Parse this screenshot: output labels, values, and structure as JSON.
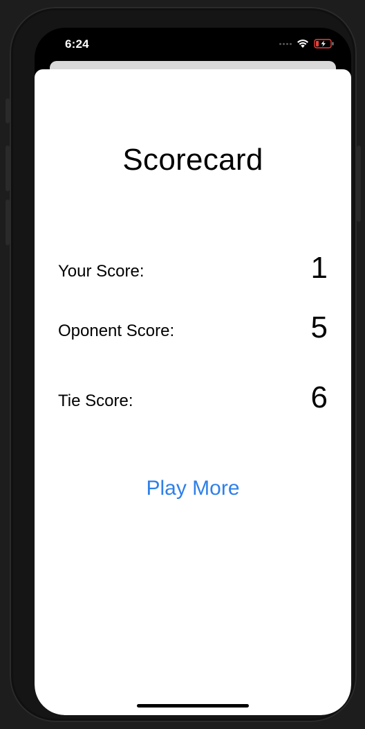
{
  "status_bar": {
    "time": "6:24",
    "icons": [
      "signal-dots-icon",
      "wifi-icon",
      "battery-charging-icon"
    ]
  },
  "scorecard": {
    "title": "Scorecard",
    "rows": [
      {
        "label": "Your Score:",
        "value": "1"
      },
      {
        "label": "Oponent Score:",
        "value": "5"
      },
      {
        "label": "Tie Score:",
        "value": "6"
      }
    ],
    "play_more_label": "Play More"
  },
  "colors": {
    "accent": "#2f80e8",
    "battery": "#e8403a"
  }
}
